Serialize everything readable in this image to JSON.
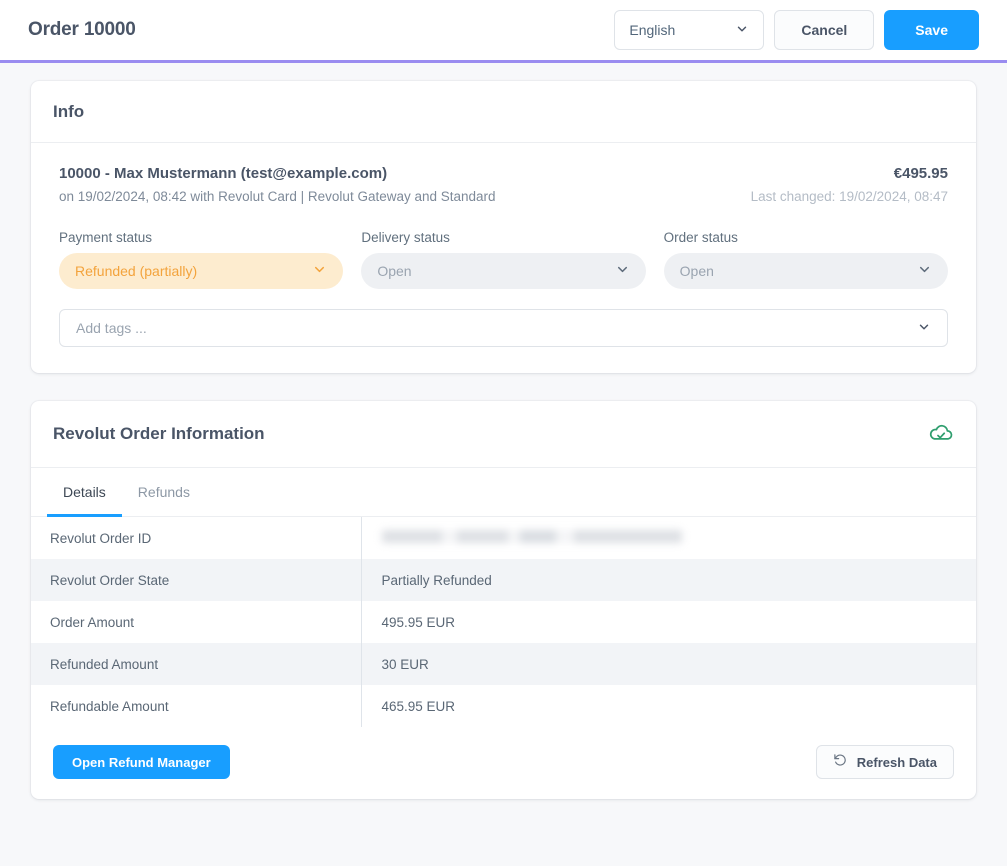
{
  "topbar": {
    "title": "Order 10000",
    "language_value": "English",
    "cancel_label": "Cancel",
    "save_label": "Save",
    "accent_color": "#9a8cf0"
  },
  "info_card": {
    "title": "Info",
    "customer_line": "10000 - Max Mustermann (test@example.com)",
    "meta_line": "on 19/02/2024, 08:42 with Revolut Card | Revolut Gateway and Standard",
    "amount": "€495.95",
    "last_changed": "Last changed: 19/02/2024, 08:47",
    "fields": [
      {
        "label": "Payment status",
        "value": "Refunded (partially)",
        "style": "warning"
      },
      {
        "label": "Delivery status",
        "value": "Open",
        "style": "muted"
      },
      {
        "label": "Order status",
        "value": "Open",
        "style": "muted"
      }
    ],
    "tags_placeholder": "Add tags ..."
  },
  "revolut_card": {
    "title": "Revolut Order Information",
    "status_icon": "cloud-check-icon",
    "status_icon_color": "#2f9e6e",
    "tabs": [
      {
        "label": "Details",
        "active": true
      },
      {
        "label": "Refunds",
        "active": false
      }
    ],
    "rows": [
      {
        "key": "Revolut Order ID",
        "value": "",
        "blurred": true
      },
      {
        "key": "Revolut Order State",
        "value": "Partially Refunded",
        "blurred": false
      },
      {
        "key": "Order Amount",
        "value": "495.95 EUR",
        "blurred": false
      },
      {
        "key": "Refunded Amount",
        "value": "30 EUR",
        "blurred": false
      },
      {
        "key": "Refundable Amount",
        "value": "465.95 EUR",
        "blurred": false
      }
    ],
    "open_refund_manager_label": "Open Refund Manager",
    "refresh_label": "Refresh Data",
    "refresh_icon": "refresh-ccw-icon"
  }
}
